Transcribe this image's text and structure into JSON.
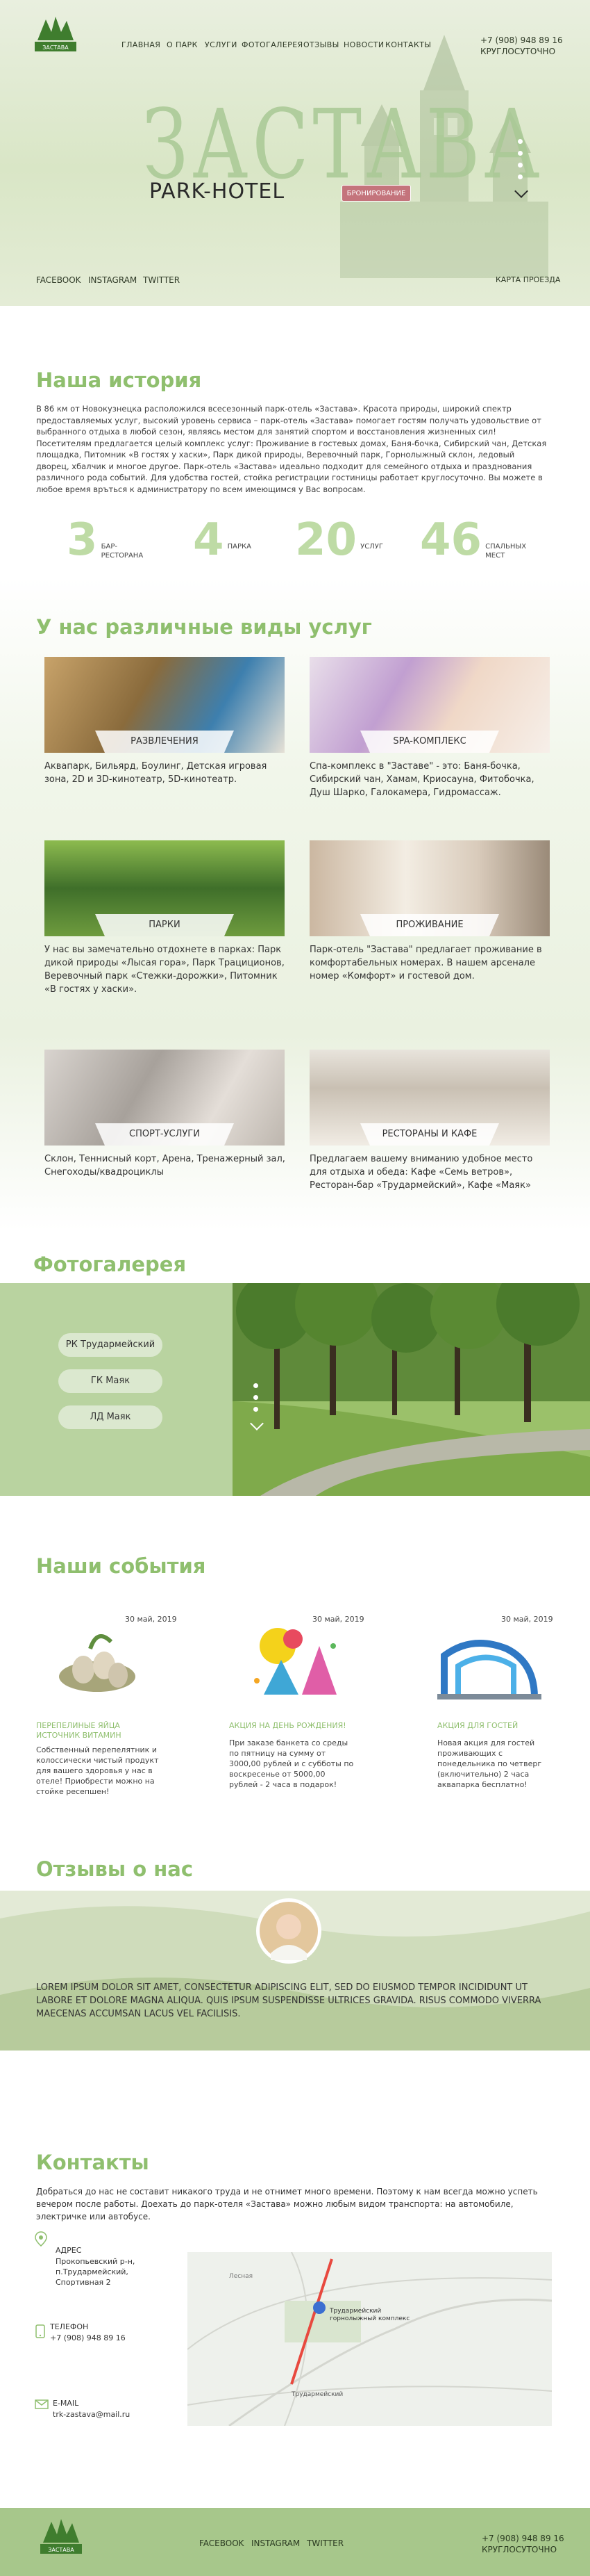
{
  "header": {
    "nav": [
      "Главная",
      "О парк",
      "Услуги",
      "Фотогалерея",
      "Отзывы",
      "Новости",
      "Контакты"
    ],
    "phone": "+7 (908) 948 89 16",
    "hours": "КРУГЛОСУТОЧНО",
    "logo_text": "ЗАСТАВА"
  },
  "hero": {
    "title": "ЗАСТАВА",
    "subtitle": "PARK-HOTEL",
    "book_button": "БРОНИРОВАНИЕ",
    "social": [
      "FACEBOOK",
      "INSTAGRAM",
      "TWITTER"
    ],
    "map_link": "КАРТА ПРОЕЗДА"
  },
  "history": {
    "title": "Наша история",
    "text": "В 86 км от Новокузнецка расположился всесезонный парк-отель «Застава». Красота природы, широкий спектр предоставляемых услуг, высокий уровень сервиса – парк-отель «Застава» помогает гостям получать удовольствие от выбранного отдыха в любой сезон, являясь местом для занятий спортом и восстановления жизненных сил!Посетителям предлагается целый комплекс услуг: Проживание в гостевых домах, Баня-бочка, Сибирский чан, Детская площадка, Питомник «В гостях у хаски», Парк дикой природы, Веревочный парк, Горнолыжный склон, ледовый дворец, хбалчик и многое другое. Парк-отель «Застава» идеально подходит для семейного отдыха и празднования различного рода событий. Для удобства гостей, стойка регистрации гостиницы работает круглосуточно. Вы можете в любое время връться к администратору по всем имеющимся у Вас вопросам.",
    "stats": [
      {
        "num": "3",
        "label": "БАР-РЕСТОРАНА"
      },
      {
        "num": "4",
        "label": "ПАРКА"
      },
      {
        "num": "20",
        "label": "УСЛУГ"
      },
      {
        "num": "46",
        "label": "СПАЛЬНЫХ МЕСТ"
      }
    ]
  },
  "services": {
    "title": "У нас различные виды услуг",
    "items": [
      {
        "label": "РАЗВЛЕЧЕНИЯ",
        "text": "Аквапарк, Бильярд, Боулинг, Детская игровая зона, 2D и 3D-кинотеатр, 5D-кинотеатр."
      },
      {
        "label": "SPA-КОМПЛЕКС",
        "text": "Спа-комплекс в \"Заставе\" - это: Баня-бочка, Сибирский чан, Хамам, Криосауна, Фитобочка, Душ Шарко, Галокамера, Гидромассаж."
      },
      {
        "label": "ПАРКИ",
        "text": "У нас вы замечательно отдохнете в парках: Парк дикой природы «Лысая гора», Парк Трациционов, Веревочный парк «Стежки-дорожки», Питомник «В гостях у хаски»."
      },
      {
        "label": "ПРОЖИВАНИЕ",
        "text": "Парк-отель \"Застава\" предлагает проживание в комфортабельных номерах. В нашем арсенале номер «Комфорт» и гостевой дом."
      },
      {
        "label": "СПОРТ-УСЛУГИ",
        "text": "Склон, Теннисный корт, Арена, Тренажерный зал, Снегоходы/квадроциклы"
      },
      {
        "label": "РЕСТОРАНЫ И КАФЕ",
        "text": "Предлагаем вашему вниманию удобное место для отдыха и обеда: Кафе «Семь ветров», Ресторан-бар «Трудармейский», Кафе «Маяк»"
      }
    ]
  },
  "gallery": {
    "title": "Фотогалерея",
    "buttons": [
      "РК Трудармейский",
      "ГК Маяк",
      "ЛД Маяк"
    ]
  },
  "events": {
    "title": "Наши события",
    "items": [
      {
        "date": "30 май, 2019",
        "title": "ПЕРЕПЕЛИНЫЕ ЯЙЦА ИСТОЧНИК ВИТАМИН",
        "text": "Собственный перепелятник и колоссически чистый продукт для вашего здоровья у нас в отеле! Приобрести можно на стойке ресепшен!"
      },
      {
        "date": "30 май, 2019",
        "title": "АКЦИЯ НА ДЕНЬ РОЖДЕНИЯ!",
        "text": "При заказе банкета со среды по пятницу на сумму от 3000,00 рублей и с субботы по воскресенье от 5000,00 рублей - 2 часа в подарок!"
      },
      {
        "date": "30 май, 2019",
        "title": "АКЦИЯ ДЛЯ ГОСТЕЙ",
        "text": "Новая акция для гостей проживающих с понедельника по четверг (включительно) 2 часа аквапарка бесплатно!"
      }
    ]
  },
  "reviews": {
    "title": "Отзывы о нас",
    "text": "Lorem ipsum dolor sit amet, consectetur adipiscing elit, sed do eiusmod tempor incididunt ut labore et dolore magna aliqua. Quis ipsum suspendisse ultrices gravida. Risus commodo viverra maecenas accumsan lacus vel facilisis."
  },
  "contacts": {
    "title": "Контакты",
    "text": "Добраться до нас не составит никакого труда и не отнимет много времени. Поэтому к нам всегда можно успеть вечером после работы. Доехать до парк-отеля «Застава» можно любым видом транспорта: на автомобиле, электричке или автобусе.",
    "address_label": "Адрес",
    "address": "Прокопьевский р-н, п.Трудармейский, Спортивная 2",
    "phone_label": "Телефон",
    "phone": "+7 (908) 948 89 16",
    "email_label": "E-mail",
    "email": "trk-zastava@mail.ru",
    "map_labels": [
      "Трудармейский горнолыжный комплекс",
      "Трудармейский",
      "Лесная"
    ]
  },
  "footer": {
    "social": [
      "FACEBOOK",
      "INSTAGRAM",
      "TWITTER"
    ],
    "phone": "+7 (908) 948 89 16",
    "hours": "КРУГЛОСУТОЧНО"
  },
  "colors": {
    "accent": "#8fbf6e",
    "book": "#c4747c",
    "footer": "#a7c78b"
  }
}
